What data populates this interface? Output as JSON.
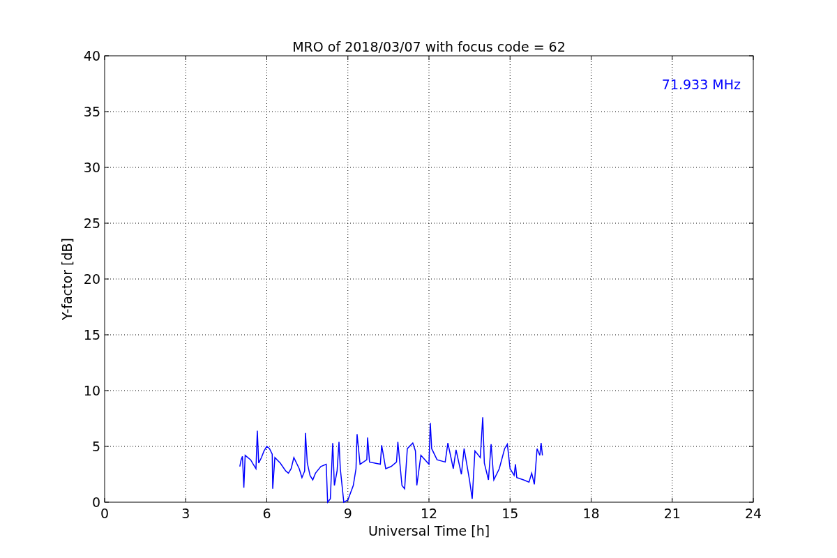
{
  "chart_data": {
    "type": "line",
    "title": "MRO of 2018/03/07 with focus code = 62",
    "xlabel": "Universal Time [h]",
    "ylabel": "Y-factor [dB]",
    "xlim": [
      0,
      24
    ],
    "ylim": [
      0,
      40
    ],
    "xticks": [
      0,
      3,
      6,
      9,
      12,
      15,
      18,
      21,
      24
    ],
    "yticks": [
      0,
      5,
      10,
      15,
      20,
      25,
      30,
      35,
      40
    ],
    "x": [
      5.0,
      5.05,
      5.1,
      5.15,
      5.2,
      5.4,
      5.5,
      5.6,
      5.65,
      5.7,
      5.8,
      5.9,
      6.0,
      6.1,
      6.2,
      6.22,
      6.3,
      6.5,
      6.7,
      6.8,
      6.9,
      7.0,
      7.2,
      7.3,
      7.4,
      7.43,
      7.5,
      7.6,
      7.7,
      7.8,
      8.0,
      8.2,
      8.25,
      8.35,
      8.44,
      8.5,
      8.6,
      8.67,
      8.72,
      8.85,
      9.0,
      9.2,
      9.3,
      9.34,
      9.45,
      9.7,
      9.73,
      9.8,
      10.2,
      10.25,
      10.4,
      10.6,
      10.8,
      10.85,
      11.0,
      11.1,
      11.2,
      11.4,
      11.5,
      11.55,
      11.7,
      12.0,
      12.05,
      12.1,
      12.3,
      12.6,
      12.7,
      12.9,
      13.0,
      13.2,
      13.3,
      13.5,
      13.6,
      13.7,
      13.9,
      13.99,
      14.05,
      14.2,
      14.3,
      14.4,
      14.6,
      14.8,
      14.9,
      15.0,
      15.15,
      15.2,
      15.25,
      15.5,
      15.7,
      15.8,
      15.9,
      16.0,
      16.1,
      16.15,
      16.2
    ],
    "series": [
      {
        "color": "#0000ff",
        "values": [
          3.2,
          3.8,
          4.1,
          1.3,
          4.2,
          3.8,
          3.4,
          3.0,
          6.4,
          3.5,
          4.0,
          4.6,
          5.0,
          4.8,
          4.3,
          1.2,
          4.0,
          3.5,
          2.8,
          2.6,
          3.0,
          4.0,
          3.0,
          2.2,
          2.8,
          6.2,
          3.5,
          2.4,
          2.0,
          2.6,
          3.2,
          3.4,
          0.0,
          0.3,
          5.3,
          1.5,
          2.8,
          5.4,
          3.0,
          0.0,
          0.2,
          1.5,
          3.0,
          6.1,
          3.4,
          3.8,
          5.8,
          3.6,
          3.4,
          5.1,
          3.0,
          3.2,
          3.6,
          5.4,
          1.5,
          1.2,
          4.8,
          5.3,
          4.6,
          1.5,
          4.2,
          3.4,
          7.1,
          4.8,
          3.8,
          3.6,
          5.3,
          3.0,
          4.7,
          2.5,
          4.8,
          2.0,
          0.3,
          4.6,
          4.0,
          7.6,
          3.5,
          2.0,
          5.2,
          2.0,
          3.0,
          4.8,
          5.2,
          3.0,
          2.4,
          3.4,
          2.2,
          2.0,
          1.8,
          2.6,
          1.6,
          4.8,
          4.2,
          5.3,
          4.2
        ]
      }
    ],
    "annotations": [
      "71.933 MHz"
    ],
    "grid": true
  }
}
